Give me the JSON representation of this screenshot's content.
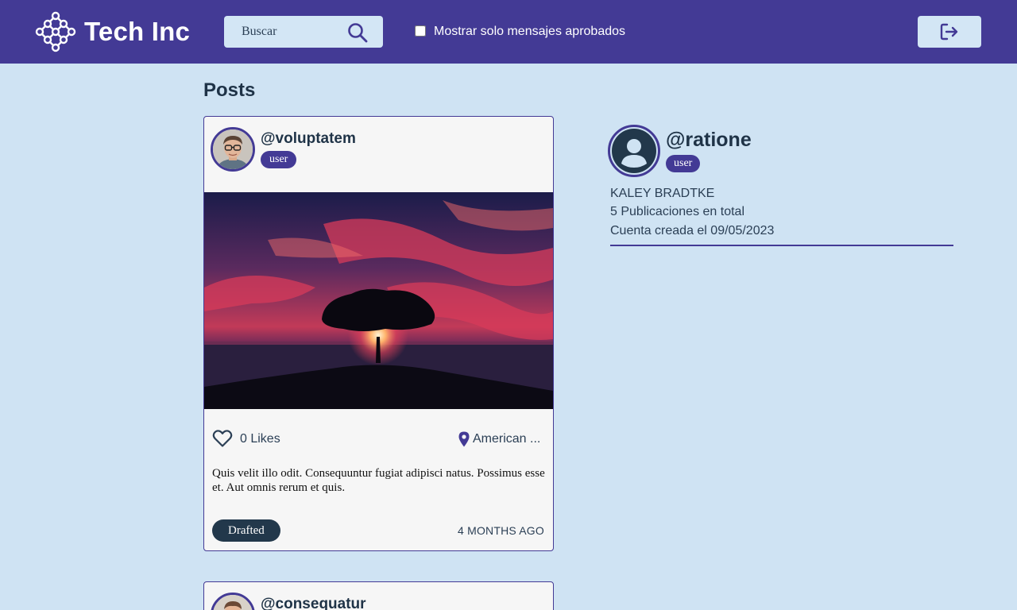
{
  "header": {
    "brand": "Tech Inc",
    "search_placeholder": "Buscar",
    "filter_label": "Mostrar solo mensajes aprobados",
    "filter_checked": false,
    "logout_icon": "logout-icon"
  },
  "main": {
    "section_title": "Posts",
    "posts": [
      {
        "username": "@voluptatem",
        "role": "user",
        "likes": "0 Likes",
        "location": "American ...",
        "body": "Quis velit illo odit. Consequuntur fugiat adipisci natus. Possimus esse et. Aut omnis rerum et quis.",
        "status": "Drafted",
        "time": "4 MONTHS AGO"
      },
      {
        "username": "@consequatur"
      }
    ]
  },
  "profile": {
    "username": "@ratione",
    "role": "user",
    "name": "KALEY BRADTKE",
    "posts_total": "5 Publicaciones en total",
    "created": "Cuenta creada el 09/05/2023"
  },
  "colors": {
    "primary": "#433a95",
    "background": "#cfe3f3",
    "card": "#f6f6f6",
    "dark": "#22384b"
  }
}
